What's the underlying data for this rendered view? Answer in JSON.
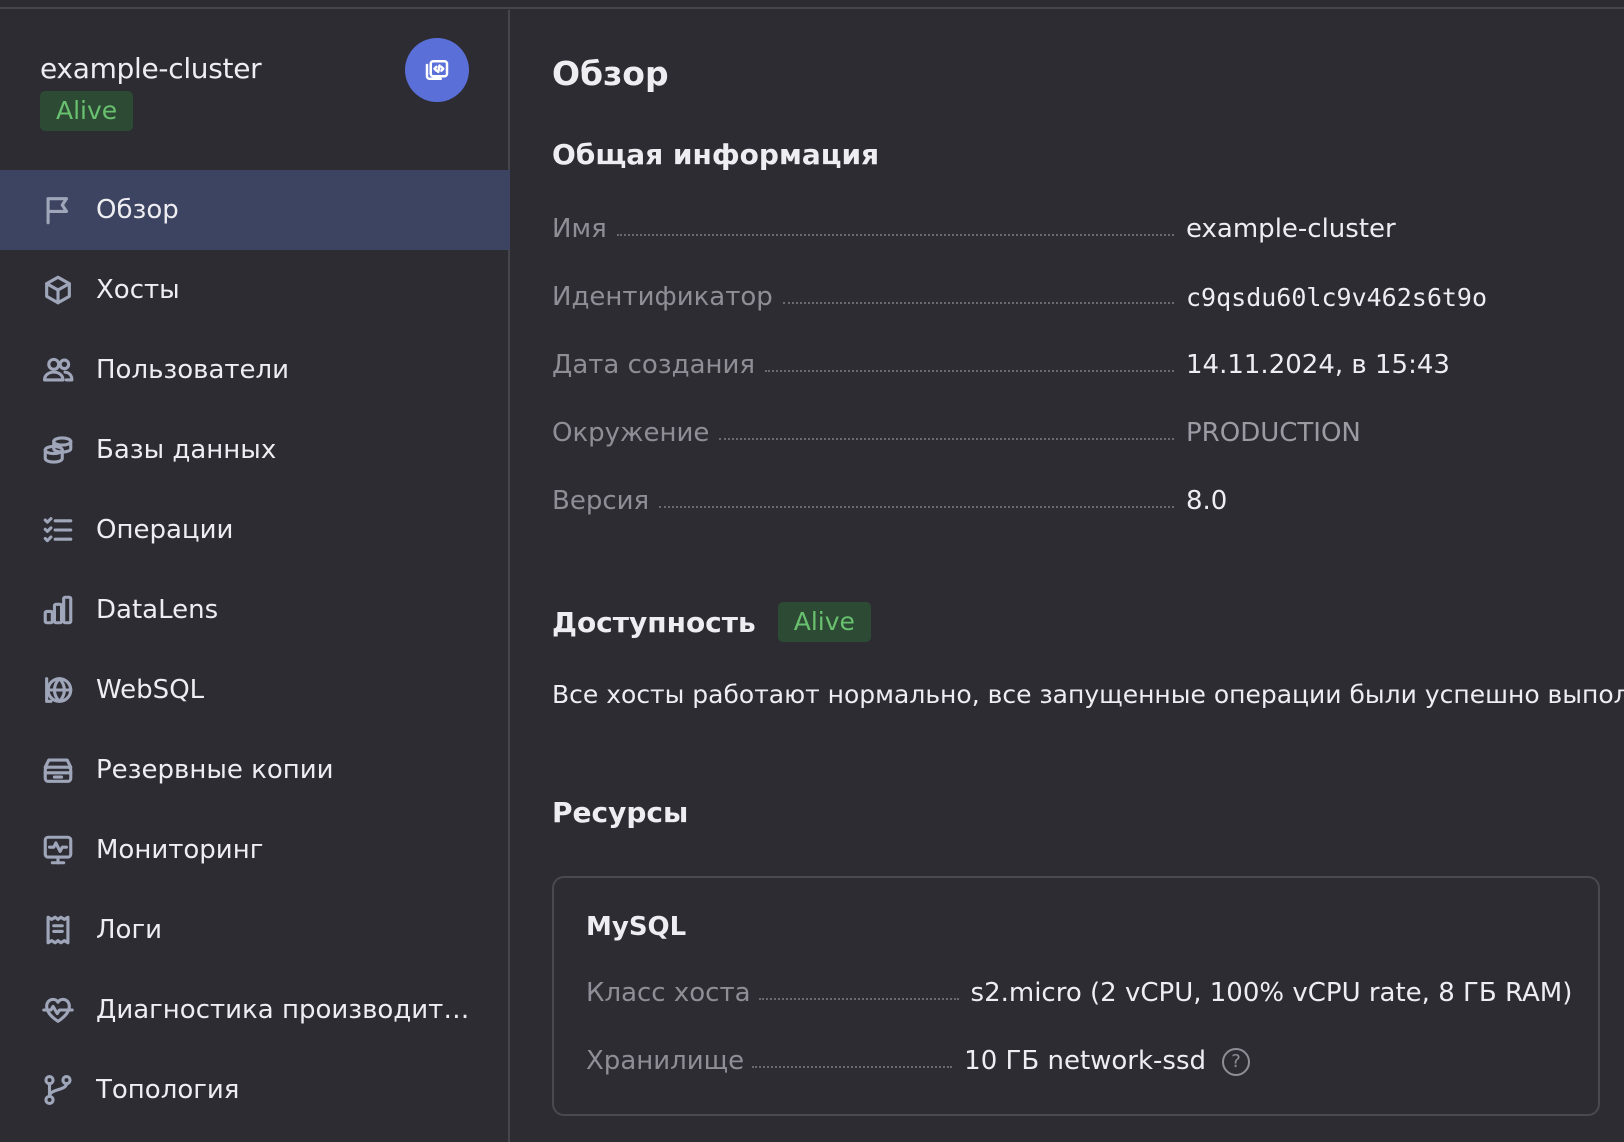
{
  "cluster": {
    "name": "example-cluster",
    "status": "Alive"
  },
  "nav": {
    "items": [
      {
        "label": "Обзор",
        "icon": "flag-icon"
      },
      {
        "label": "Хосты",
        "icon": "cube-icon"
      },
      {
        "label": "Пользователи",
        "icon": "users-icon"
      },
      {
        "label": "Базы данных",
        "icon": "databases-icon"
      },
      {
        "label": "Операции",
        "icon": "list-check-icon"
      },
      {
        "label": "DataLens",
        "icon": "bar-chart-icon"
      },
      {
        "label": "WebSQL",
        "icon": "globe-icon"
      },
      {
        "label": "Резервные копии",
        "icon": "archive-icon"
      },
      {
        "label": "Мониторинг",
        "icon": "monitor-pulse-icon"
      },
      {
        "label": "Логи",
        "icon": "receipt-icon"
      },
      {
        "label": "Диагностика производитель...",
        "icon": "heart-pulse-icon"
      },
      {
        "label": "Топология",
        "icon": "branch-icon"
      }
    ]
  },
  "main": {
    "title": "Обзор",
    "general": {
      "title": "Общая информация",
      "rows": [
        {
          "key": "Имя",
          "value": "example-cluster"
        },
        {
          "key": "Идентификатор",
          "value": "c9qsdu60lc9v462s6t9o"
        },
        {
          "key": "Дата создания",
          "value": "14.11.2024, в 15:43"
        },
        {
          "key": "Окружение",
          "value": "PRODUCTION"
        },
        {
          "key": "Версия",
          "value": "8.0"
        }
      ]
    },
    "availability": {
      "title": "Доступность",
      "status": "Alive",
      "text": "Все хосты работают нормально, все запущенные операции были успешно выполнены."
    },
    "resources": {
      "title": "Ресурсы",
      "card_title": "MySQL",
      "rows": [
        {
          "key": "Класс хоста",
          "value": "s2.micro (2 vCPU, 100% vCPU rate, 8 ГБ RAM)"
        },
        {
          "key": "Хранилище",
          "value": "10 ГБ network-ssd",
          "help": "?"
        }
      ]
    }
  },
  "colors": {
    "background": "#2d2c33",
    "active_nav": "#3d4461",
    "accent": "#5b6fd8",
    "alive_bg": "#2c4a34",
    "alive_text": "#69c06e"
  }
}
